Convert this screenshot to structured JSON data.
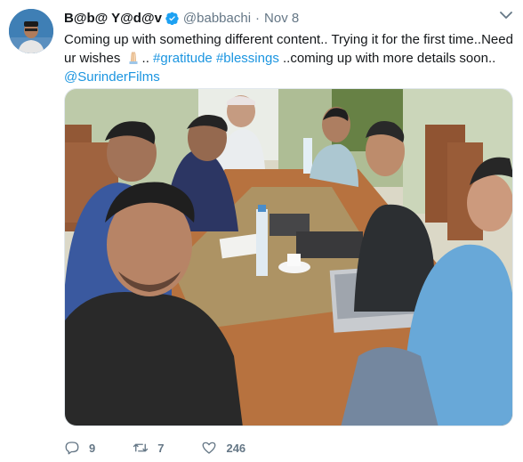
{
  "tweet": {
    "display_name": "B@b@ Y@d@v",
    "handle": "@babbachi",
    "separator": "·",
    "time": "Nov 8",
    "text_part1": "Coming up with something different content.. Trying it for the first time..Need ur wishes",
    "text_part2": "..",
    "hashtag1": "#gratitude",
    "hashtag2": "#blessings",
    "text_part3": "..coming up with more details soon..",
    "mention": "@SurinderFilms",
    "icons": {
      "verified": "verified-badge-icon",
      "more": "chevron-down-icon",
      "reply": "reply-icon",
      "retweet": "retweet-icon",
      "like": "heart-icon",
      "emoji": "folded-hands-emoji-icon"
    },
    "colors": {
      "link": "#1b95e0",
      "secondary_text": "#657786",
      "verified": "#1da1f2"
    }
  },
  "actions": {
    "replies": "9",
    "retweets": "7",
    "likes": "246"
  }
}
